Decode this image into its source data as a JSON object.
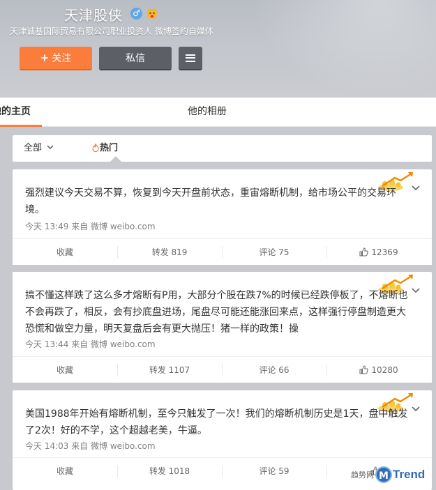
{
  "profile": {
    "name": "天津股侠",
    "gender_symbol": "♂",
    "verification": "天津诚基国际贸易有限公司职业投资人 微博签约自媒体",
    "follow_label": "关注",
    "message_label": "私信"
  },
  "tabs": {
    "home": "他的主页",
    "album": "他的相册"
  },
  "filter": {
    "all": "全部",
    "hot": "热门"
  },
  "posts": [
    {
      "text": "强烈建议今天交易不算，恢复到今天开盘前状态，重宙熔断机制，给市场公平的交易环境。",
      "time": "今天 13:49",
      "source": "来自 微博 weibo.com",
      "favorite": "收藏",
      "repost": "转发 819",
      "comment": "评论 75",
      "likes": "12369"
    },
    {
      "text": "搞不懂这样跌了这么多才熔断有P用，大部分个股在跌7%的时候已经跌停板了，不熔断也不会再跌了，相反，会有抄底盘进场，尾盘尽可能还能涨回来点，这样强行停盘制造更大恐慌和做空力量，明天复盘后会有更大抛压！猪一样的政策！操",
      "time": "今天 13:44",
      "source": "来自 微博 weibo.com",
      "favorite": "收藏",
      "repost": "转发 1107",
      "comment": "评论 66",
      "likes": "10280"
    },
    {
      "text": "美国1988年开始有熔断机制，至今只触发了一次！我们的熔断机制历史是1天，盘中触发了2次！好的不学，这个超越老美，牛逼。",
      "time": "今天 14:03",
      "source": "来自 微博 weibo.com",
      "favorite": "收藏",
      "repost": "转发 1018",
      "comment": "评论 59",
      "likes": "6"
    }
  ],
  "watermark": {
    "text": "趋势网",
    "logo_letter": "M",
    "brand": "Trend"
  },
  "colors": {
    "accent": "#fa7d3c",
    "dark_button": "#5c5f66",
    "background": "#c7c9ce",
    "watermark_blue": "#2f6db5"
  },
  "icons": [
    "gender-male-icon",
    "vip-badge-icon",
    "menu-icon",
    "chevron-down-icon",
    "flame-icon",
    "medal-icon",
    "thumb-up-icon"
  ]
}
